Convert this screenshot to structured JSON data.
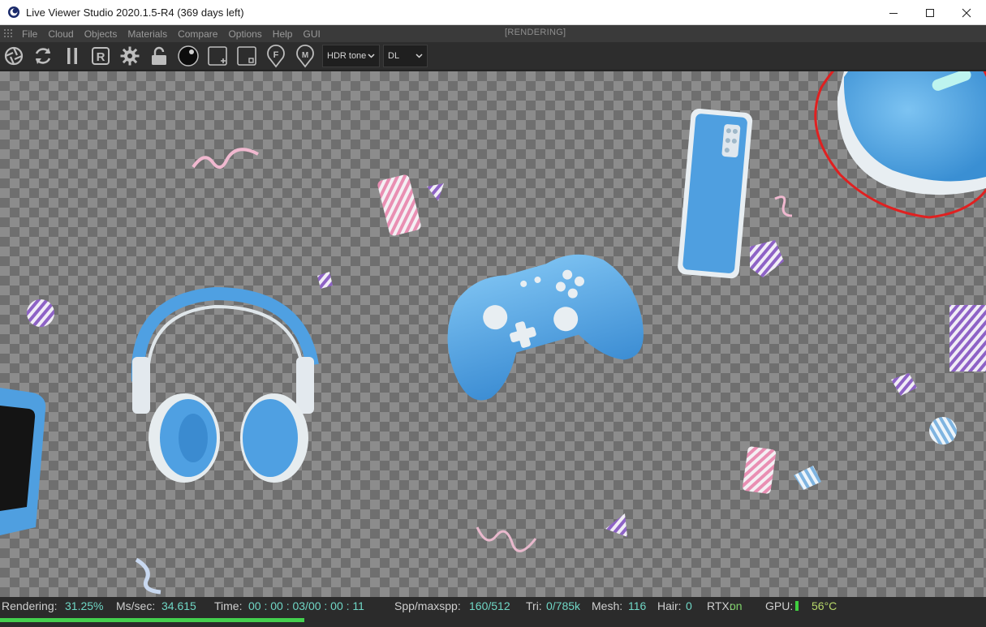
{
  "window": {
    "title": "Live Viewer Studio 2020.1.5-R4 (369 days left)",
    "controls": [
      "minimize",
      "maximize",
      "close"
    ]
  },
  "menubar": {
    "items": [
      "File",
      "Cloud",
      "Objects",
      "Materials",
      "Compare",
      "Options",
      "Help",
      "GUI"
    ],
    "state_text": "[RENDERING]"
  },
  "toolbar": {
    "icons": [
      "aperture-icon",
      "refresh-icon",
      "pause-icon",
      "region-render-icon",
      "settings-gear-icon",
      "lock-icon",
      "material-ball-icon",
      "add-box-icon",
      "box-icon",
      "focus-pin-icon",
      "material-pin-icon"
    ],
    "tonemap_select": "HDR tone",
    "kernel_select": "DL"
  },
  "status": {
    "rendering_label": "Rendering:",
    "rendering_value": "31.25%",
    "progress_fraction": 0.3125,
    "mssec_label": "Ms/sec:",
    "mssec_value": "34.615",
    "time_label": "Time:",
    "time_value": "00 : 00 : 03/00 : 00 : 11",
    "spp_label": "Spp/maxspp:",
    "spp_value": "160/512",
    "tri_label": "Tri:",
    "tri_value": "0/785k",
    "mesh_label": "Mesh:",
    "mesh_value": "116",
    "hair_label": "Hair:",
    "hair_value": "0",
    "rtx_label": "RTX:",
    "rtx_value": "on",
    "gpu_label": "GPU:",
    "gpu_temp": "56°C"
  },
  "colors": {
    "accent_blue": "#5aa8e6",
    "annotation_red": "#e02020",
    "progress_green": "#43d04e",
    "status_value": "#6fd6c5"
  }
}
